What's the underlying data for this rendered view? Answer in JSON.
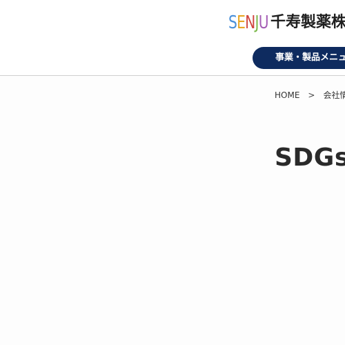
{
  "header": {
    "logo_mark": [
      "S",
      "E",
      "N",
      "J",
      "U"
    ],
    "logo_text": "千寿製薬株",
    "menu_button_label": "事業・製品メニュー"
  },
  "breadcrumb": {
    "home": "HOME",
    "separator": ">",
    "current": "会社情報"
  },
  "main": {
    "title": "SDGsへ"
  },
  "colors": {
    "menu_button_bg": "#0e2b5f",
    "logo_s": "#4a90d9",
    "logo_e": "#e8a623",
    "logo_n": "#d0453f",
    "logo_j": "#7bb84a",
    "logo_u": "#a45db5"
  }
}
